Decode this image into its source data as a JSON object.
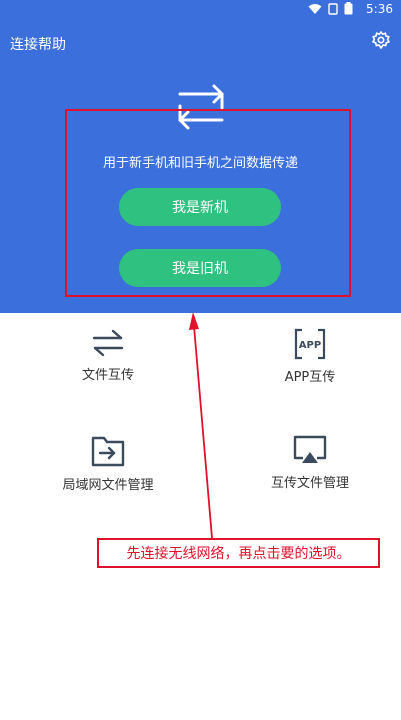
{
  "status_bar": {
    "time": "5:36"
  },
  "header": {
    "title": "连接帮助"
  },
  "hero": {
    "description": "用于新手机和旧手机之间数据传递",
    "new_phone_button": "我是新机",
    "old_phone_button": "我是旧机"
  },
  "features": [
    {
      "label": "文件互传",
      "icon": "swap-arrows-icon"
    },
    {
      "label": "APP互传",
      "icon": "app-icon",
      "icon_text": "APP"
    },
    {
      "label": "局域网文件管理",
      "icon": "folder-arrow-icon"
    },
    {
      "label": "互传文件管理",
      "icon": "airplay-icon"
    }
  ],
  "annotation": {
    "note": "先连接无线网络，再点击要的选项。"
  },
  "colors": {
    "hero_bg": "#3b6fdc",
    "button": "#2fc17f",
    "annotation": "#e0112b"
  }
}
